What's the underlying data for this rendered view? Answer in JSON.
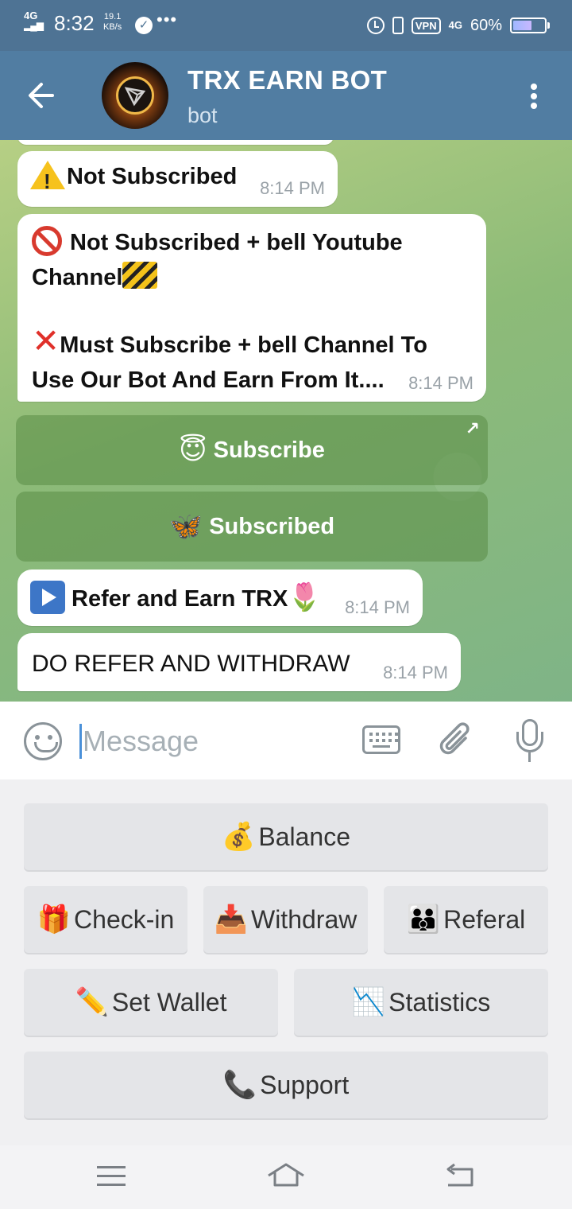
{
  "status_bar": {
    "network": "4G",
    "time": "8:32",
    "speed_value": "19.1",
    "speed_unit": "KB/s",
    "vpn": "VPN",
    "mobile_data": "4G",
    "battery": "60%",
    "battery_level": 0.6
  },
  "header": {
    "title": "TRX EARN BOT",
    "subtitle": "bot"
  },
  "messages": [
    {
      "text": "Not Subscribed",
      "time": "8:14 PM"
    },
    {
      "line1": "Not Subscribed + bell Youtube",
      "line2": "Channel",
      "line3": "Must Subscribe + bell  Channel To",
      "line4": "Use Our Bot And Earn From It....",
      "time": "8:14 PM"
    },
    {
      "text": "Refer and Earn TRX",
      "time": "8:14 PM"
    },
    {
      "text": "DO REFER AND WITHDRAW",
      "time": "8:14 PM"
    }
  ],
  "inline_buttons": [
    {
      "label": "Subscribe",
      "icon": "angel-face-icon"
    },
    {
      "label": "Subscribed",
      "icon": "butterfly-icon"
    }
  ],
  "input": {
    "placeholder": "Message",
    "value": ""
  },
  "keyboard": {
    "balance": "Balance",
    "checkin": "Check-in",
    "withdraw": "Withdraw",
    "referal": "Referal",
    "set_wallet": "Set Wallet",
    "statistics": "Statistics",
    "support": "Support"
  },
  "colors": {
    "header": "#517da2",
    "status_bar": "#4e7394",
    "chat_background": "#8dbb78",
    "inline_button": "#6a9c58",
    "key_background": "#e4e5e8"
  }
}
